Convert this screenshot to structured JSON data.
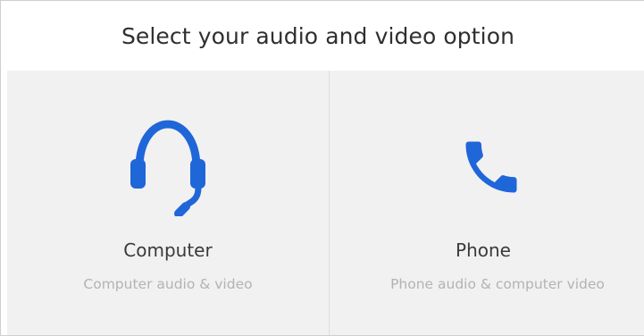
{
  "header": {
    "title": "Select your audio and video option"
  },
  "options": [
    {
      "label": "Computer",
      "sublabel": "Computer audio & video",
      "icon": "headset-icon"
    },
    {
      "label": "Phone",
      "sublabel": "Phone audio & computer video",
      "icon": "phone-icon"
    }
  ],
  "colors": {
    "accent": "#1f66d9",
    "panel_background": "#f1f1f1",
    "title_text": "#2f2f2f",
    "label_text": "#3a3a3a",
    "sublabel_text": "#b3b3b3"
  }
}
